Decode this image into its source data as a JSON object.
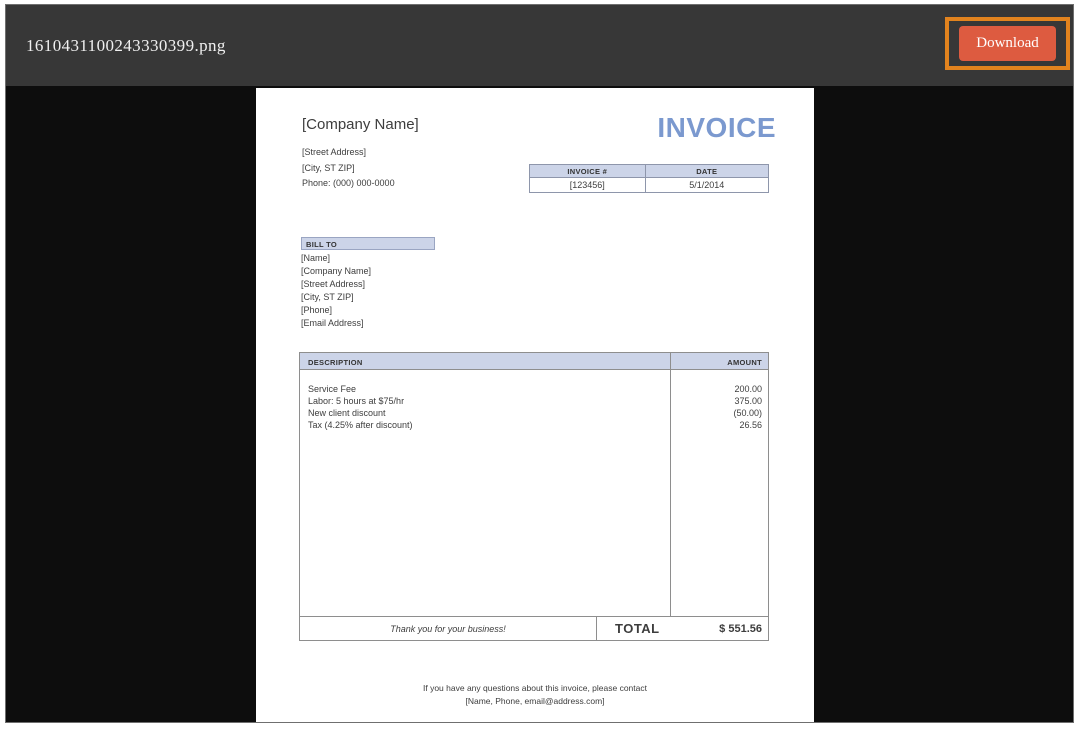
{
  "toolbar": {
    "filename": "1610431100243330399.png",
    "download_label": "Download",
    "button_color": "#dd5b40",
    "highlight_color": "#e2831e",
    "bar_color": "#373737"
  },
  "invoice": {
    "title": "INVOICE",
    "title_color": "#7b99cf",
    "company": {
      "name": "[Company Name]",
      "lines": [
        "[Street Address]",
        "[City, ST ZIP]",
        "Phone: (000) 000-0000"
      ]
    },
    "meta": {
      "invoice_no_label": "INVOICE #",
      "invoice_no": "[123456]",
      "date_label": "DATE",
      "date": "5/1/2014"
    },
    "bill_to": {
      "label": "BILL TO",
      "lines": [
        "[Name]",
        "[Company Name]",
        "[Street Address]",
        "[City, ST ZIP]",
        "[Phone]",
        "[Email Address]"
      ]
    },
    "items_table": {
      "description_header": "DESCRIPTION",
      "amount_header": "AMOUNT",
      "header_bg": "#ccd4e8",
      "items": [
        {
          "description": "Service Fee",
          "amount": "200.00"
        },
        {
          "description": "Labor: 5 hours at $75/hr",
          "amount": "375.00"
        },
        {
          "description": "New client discount",
          "amount": "(50.00)"
        },
        {
          "description": "Tax (4.25% after discount)",
          "amount": "26.56"
        }
      ],
      "thank_you": "Thank you for your business!",
      "total_label": "TOTAL",
      "total_amount": "$ 551.56"
    },
    "footer": {
      "line1": "If you have any questions about this invoice, please contact",
      "line2": "[Name, Phone, email@address.com]"
    }
  }
}
